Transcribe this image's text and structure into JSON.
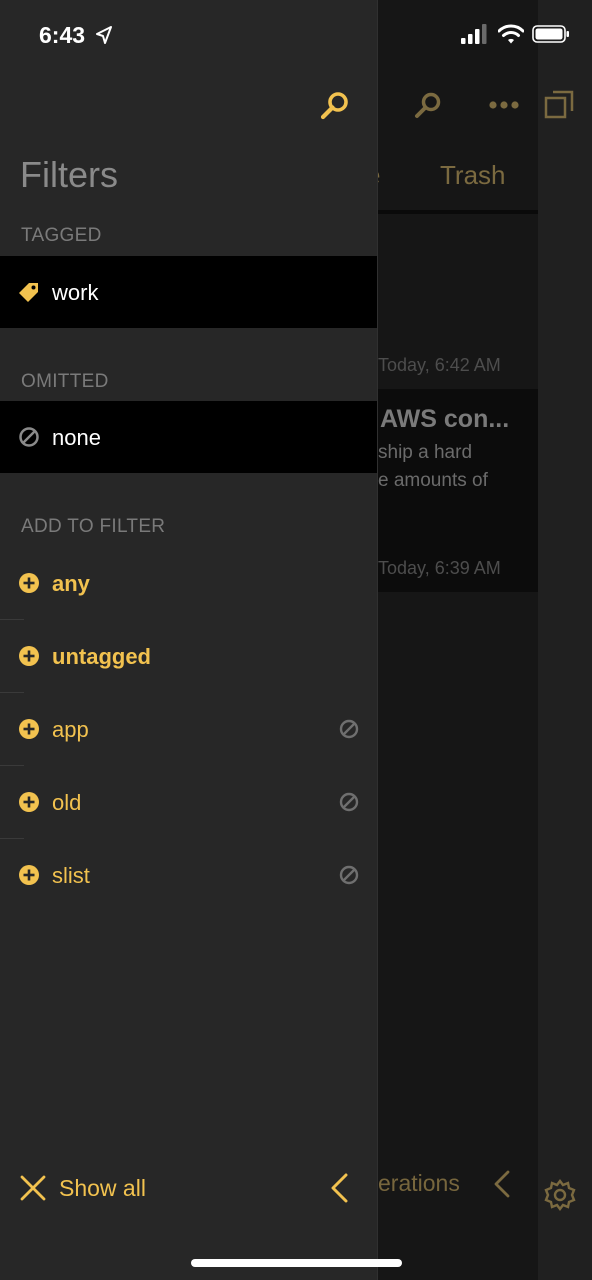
{
  "status_bar": {
    "time": "6:43"
  },
  "drawer": {
    "title": "Filters",
    "sections": {
      "tagged": {
        "label": "TAGGED",
        "items": [
          {
            "label": "work",
            "icon": "tag-icon"
          }
        ]
      },
      "omitted": {
        "label": "OMITTED",
        "items": [
          {
            "label": "none",
            "icon": "omit-icon"
          }
        ]
      },
      "add_to_filter": {
        "label": "ADD TO FILTER",
        "items": [
          {
            "label": "any",
            "bold": true,
            "omit_button": false
          },
          {
            "label": "untagged",
            "bold": true,
            "omit_button": false
          },
          {
            "label": "app",
            "bold": false,
            "omit_button": true
          },
          {
            "label": "old",
            "bold": false,
            "omit_button": true
          },
          {
            "label": "slist",
            "bold": false,
            "omit_button": true
          }
        ]
      }
    },
    "footer": {
      "show_all_label": "Show all"
    }
  },
  "background_app": {
    "tabs": [
      "e",
      "Trash"
    ],
    "notes": [
      {
        "timestamp": "Today, 6:42 AM"
      },
      {
        "title": "AWS con...",
        "lines": [
          "ship a hard",
          "e amounts of"
        ],
        "timestamp": "Today, 6:39 AM"
      }
    ],
    "bottom_text": "erations"
  },
  "colors": {
    "accent": "#f2c24f",
    "drawer_bg": "#272727",
    "selected_row_bg": "#000000",
    "muted_text": "#7a7a7a"
  }
}
